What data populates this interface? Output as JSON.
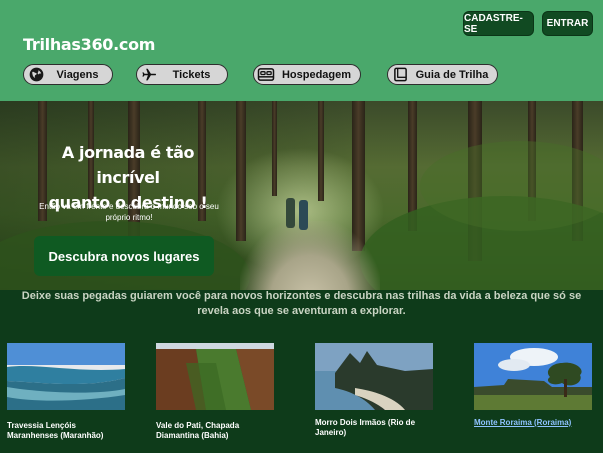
{
  "header": {
    "brand": "Trilhas360.com",
    "signup_label": "CADASTRE-SE",
    "login_label": "ENTRAR"
  },
  "nav": {
    "items": [
      {
        "label": "Viagens",
        "icon": "globe-icon"
      },
      {
        "label": "Tickets",
        "icon": "airplane-icon"
      },
      {
        "label": "Hospedagem",
        "icon": "bed-icon"
      },
      {
        "label": "Guia de Trilha",
        "icon": "book-icon"
      }
    ]
  },
  "hero": {
    "title_line1": "A jornada é tão incrível",
    "title_line2": "quanto o destino !",
    "subtitle_line1": "Então vá em frente e descubra o mundo sob o seu",
    "subtitle_line2": "próprio ritmo!",
    "cta_label": "Descubra novos lugares"
  },
  "tagline": {
    "line1": "Deixe suas pegadas guiarem você para novos horizontes e descubra nas trilhas da vida a beleza que só se",
    "line2": "revela aos que se aventuram a explorar."
  },
  "destinations": [
    {
      "line1": "Travessia Lençóis",
      "line2": "Maranhenses (Maranhão)"
    },
    {
      "line1": "Vale do Pati, Chapada",
      "line2": "Diamantina (Bahia)"
    },
    {
      "line1": "Morro Dois Irmãos (Rio de",
      "line2": "Janeiro)"
    },
    {
      "line1": "Monte Roraima (Roraima)",
      "line2": ""
    }
  ],
  "colors": {
    "header_bg": "#4aa86b",
    "dark_green": "#114a22",
    "page_bg": "#0e3b1a",
    "link": "#8ec3ff"
  }
}
